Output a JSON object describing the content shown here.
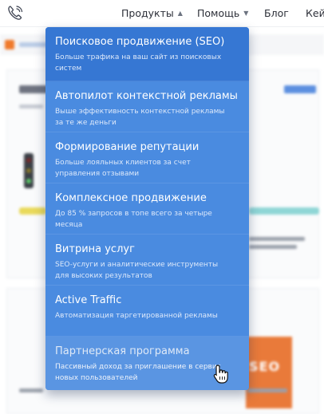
{
  "nav": {
    "items": [
      {
        "label": "Продукты",
        "has_dropdown": true,
        "open": true
      },
      {
        "label": "Помощь",
        "has_dropdown": true,
        "open": false
      },
      {
        "label": "Блог",
        "has_dropdown": false
      },
      {
        "label": "Кей",
        "has_dropdown": false
      }
    ]
  },
  "dropdown": {
    "items": [
      {
        "title": "Поисковое продвижение (SEO)",
        "description": "Больше трафика на ваш сайт из поисковых систем",
        "state": "selected"
      },
      {
        "title": "Автопилот контекстной рекламы",
        "description": "Выше эффективность контекстной рекламы за те же деньги",
        "state": "normal"
      },
      {
        "title": "Формирование репутации",
        "description": "Больше лояльных клиентов за счет управления отзывами",
        "state": "normal"
      },
      {
        "title": "Комплексное продвижение",
        "description": "До 85 % запросов в топе всего за четыре месяца",
        "state": "normal"
      },
      {
        "title": "Витрина услуг",
        "description": "SEO-услуги и аналитические инструменты для высоких результатов",
        "state": "normal"
      },
      {
        "title": "Active Traffic",
        "description": "Автоматизация таргетированной рекламы",
        "state": "normal"
      },
      {
        "title": "Партнерская программа",
        "description": "Пассивный доход за приглашение в сервис новых пользователей",
        "state": "hovered"
      }
    ]
  },
  "background": {
    "seo_block_text": "SEO"
  },
  "colors": {
    "dropdown_bg": "#4a8be0",
    "dropdown_selected": "#3677d3",
    "dropdown_hover": "#5a95e2",
    "accent_orange": "#e97a3a",
    "text_dark": "#2c2f38"
  },
  "icons": {
    "phone": "phone-icon",
    "chevron": "chevron-down-icon",
    "cursor": "hand-pointer-cursor-icon"
  }
}
